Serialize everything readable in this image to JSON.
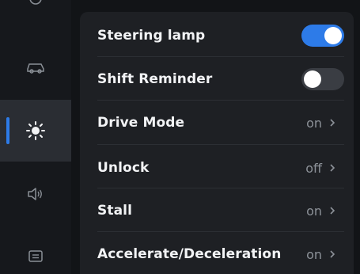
{
  "sidebar": {
    "items": [
      {
        "icon": "partial-icon"
      },
      {
        "icon": "car-icon"
      },
      {
        "icon": "sun-brightness-icon",
        "active": true
      },
      {
        "icon": "speaker-icon"
      },
      {
        "icon": "message-icon"
      }
    ]
  },
  "colors": {
    "accent": "#2d7be8",
    "background": "#121417",
    "panel": "#1e2024",
    "text": "#f2f3f5",
    "muted": "#8d9299"
  },
  "settings": {
    "steering_lamp": {
      "label": "Steering lamp",
      "state": "on"
    },
    "shift_reminder": {
      "label": "Shift Reminder",
      "state": "off"
    },
    "drive_mode": {
      "label": "Drive Mode",
      "value": "on"
    },
    "unlock": {
      "label": "Unlock",
      "value": "off"
    },
    "stall": {
      "label": "Stall",
      "value": "on"
    },
    "accelerate": {
      "label": "Accelerate/Deceleration",
      "value": "on"
    }
  }
}
